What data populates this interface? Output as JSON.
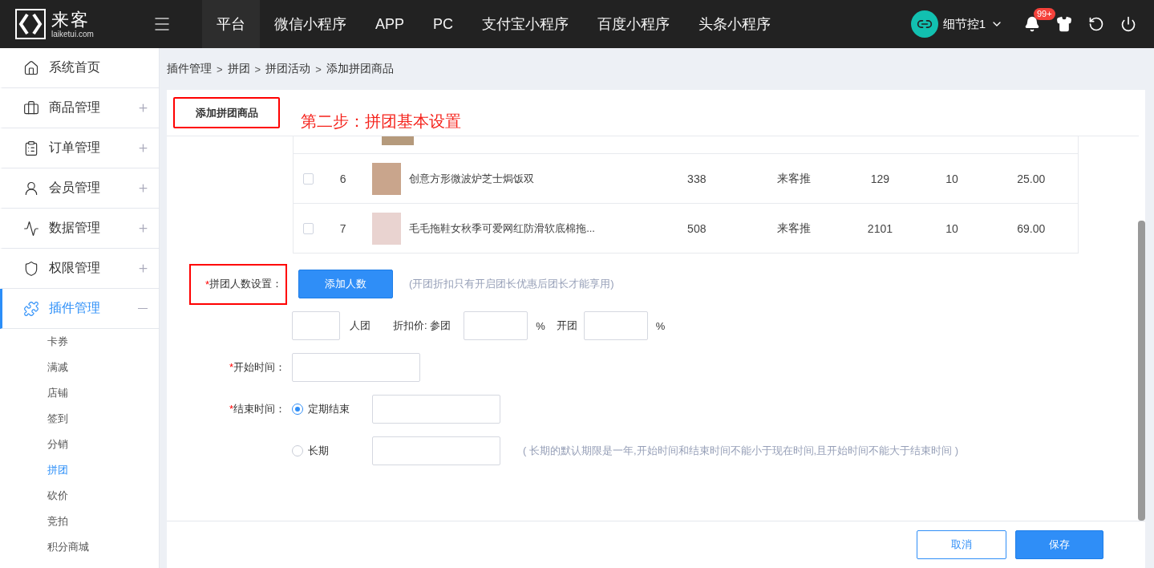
{
  "header": {
    "logo": {
      "name": "来客",
      "domain": "laiketui.com"
    },
    "nav": [
      {
        "label": "平台",
        "selected": true
      },
      {
        "label": "微信小程序",
        "selected": false
      },
      {
        "label": "APP",
        "selected": false
      },
      {
        "label": "PC",
        "selected": false
      },
      {
        "label": "支付宝小程序",
        "selected": false
      },
      {
        "label": "百度小程序",
        "selected": false
      },
      {
        "label": "头条小程序",
        "selected": false
      }
    ],
    "user": "细节控1",
    "notification_badge": "99+"
  },
  "sidebar": {
    "items": [
      {
        "label": "系统首页",
        "selected": false
      },
      {
        "label": "商品管理",
        "selected": false,
        "expanded": false
      },
      {
        "label": "订单管理",
        "selected": false,
        "expanded": false
      },
      {
        "label": "会员管理",
        "selected": false,
        "expanded": false
      },
      {
        "label": "数据管理",
        "selected": false,
        "expanded": false
      },
      {
        "label": "权限管理",
        "selected": false,
        "expanded": false
      },
      {
        "label": "插件管理",
        "selected": true,
        "expanded": true,
        "children": [
          {
            "label": "卡券",
            "selected": false
          },
          {
            "label": "满减",
            "selected": false
          },
          {
            "label": "店铺",
            "selected": false
          },
          {
            "label": "签到",
            "selected": false
          },
          {
            "label": "分销",
            "selected": false
          },
          {
            "label": "拼团",
            "selected": true
          },
          {
            "label": "砍价",
            "selected": false
          },
          {
            "label": "竞拍",
            "selected": false
          },
          {
            "label": "积分商城",
            "selected": false
          }
        ]
      }
    ]
  },
  "breadcrumb": [
    {
      "kind": "link",
      "text": "插件管理"
    },
    {
      "kind": "separator",
      "text": ">"
    },
    {
      "kind": "link",
      "text": "拼团"
    },
    {
      "kind": "separator",
      "text": ">"
    },
    {
      "kind": "link",
      "text": "拼团活动"
    },
    {
      "kind": "separator",
      "text": ">"
    },
    {
      "kind": "link",
      "text": "添加拼团商品"
    }
  ],
  "card": {
    "tab": "添加拼团商品",
    "annotation": "第二步：拼团基本设置",
    "table": {
      "rows": [
        {
          "checked": false,
          "index": "6",
          "name": "创意方形微波炉芝士焗饭双",
          "values": [
            "338",
            "来客推",
            "129",
            "10",
            "25.00"
          ]
        },
        {
          "checked": false,
          "index": "7",
          "name": "毛毛拖鞋女秋季可爱网红防滑软底棉拖...",
          "values": [
            "508",
            "来客推",
            "2101",
            "10",
            "69.00"
          ]
        }
      ]
    },
    "form": {
      "group_size": {
        "required_mark": "*",
        "label": "拼团人数设置：",
        "button": "添加人数",
        "hint": "(开团折扣只有开启团长优惠后团长才能享用)"
      },
      "group_row": {
        "unit": "人团",
        "discount_label": "折扣价: 参团",
        "percent_1": "%",
        "leader_label": "开团",
        "percent_2": "%"
      },
      "start_time": {
        "required_mark": "*",
        "label": "开始时间："
      },
      "end_time": {
        "required_mark": "*",
        "label": "结束时间：",
        "options": [
          {
            "label": "定期结束",
            "selected": true
          },
          {
            "label": "长期",
            "selected": false
          }
        ],
        "hint": "( 长期的默认期限是一年,开始时间和结束时间不能小于现在时间,且开始时间不能大于结束时间 )"
      }
    },
    "buttons": {
      "cancel": "取消",
      "save": "保存"
    }
  }
}
